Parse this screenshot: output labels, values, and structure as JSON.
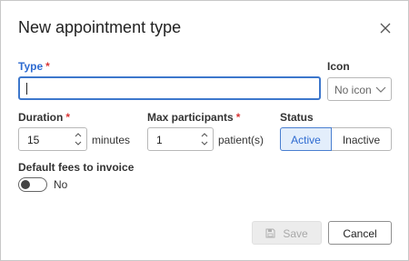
{
  "dialog": {
    "title": "New appointment type",
    "close_icon": "close-icon"
  },
  "form": {
    "type": {
      "label": "Type",
      "required_mark": "*",
      "value": ""
    },
    "icon": {
      "label": "Icon",
      "selected": "No icon",
      "chevron_icon": "chevron-down-icon"
    },
    "duration": {
      "label": "Duration",
      "required_mark": "*",
      "value": "15",
      "unit": "minutes"
    },
    "max_participants": {
      "label": "Max participants",
      "required_mark": "*",
      "value": "1",
      "unit": "patient(s)"
    },
    "status": {
      "label": "Status",
      "options": [
        "Active",
        "Inactive"
      ],
      "selected": "Active"
    },
    "default_fees": {
      "label": "Default fees to invoice",
      "toggle_state": "No",
      "on": false
    }
  },
  "footer": {
    "save_label": "Save",
    "save_icon": "save-disk-icon",
    "cancel_label": "Cancel"
  },
  "colors": {
    "accent": "#2e6bd1",
    "required": "#d93636",
    "active_segment_bg": "#e3eefb"
  }
}
